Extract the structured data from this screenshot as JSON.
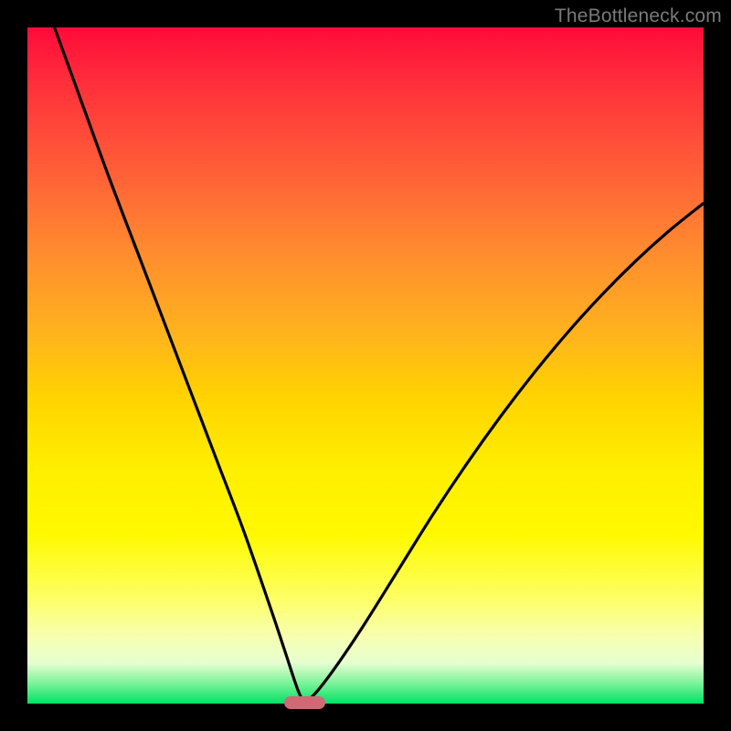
{
  "watermark": "TheBottleneck.com",
  "colors": {
    "frame": "#000000",
    "curve": "#000000",
    "marker": "#cf6a74"
  },
  "chart_data": {
    "type": "line",
    "title": "",
    "xlabel": "",
    "ylabel": "",
    "xlim": [
      0,
      100
    ],
    "ylim": [
      0,
      100
    ],
    "grid": false,
    "legend": false,
    "annotations": [
      {
        "text": "TheBottleneck.com",
        "position": "top-right"
      }
    ],
    "marker": {
      "x_center": 41,
      "width_x": 6,
      "y": 0
    },
    "series": [
      {
        "name": "left-branch",
        "x": [
          4,
          8,
          12,
          16,
          20,
          24,
          28,
          32,
          36,
          38,
          40,
          41
        ],
        "y": [
          100,
          89,
          78,
          67.5,
          57,
          46.5,
          36,
          25.5,
          14,
          8,
          2,
          0
        ]
      },
      {
        "name": "right-branch",
        "x": [
          41,
          43,
          46,
          50,
          55,
          60,
          65,
          70,
          75,
          80,
          85,
          90,
          95,
          100
        ],
        "y": [
          0,
          2,
          6,
          12,
          20,
          28,
          35.5,
          42.5,
          49,
          55,
          60.5,
          65.5,
          70,
          74
        ]
      }
    ]
  }
}
